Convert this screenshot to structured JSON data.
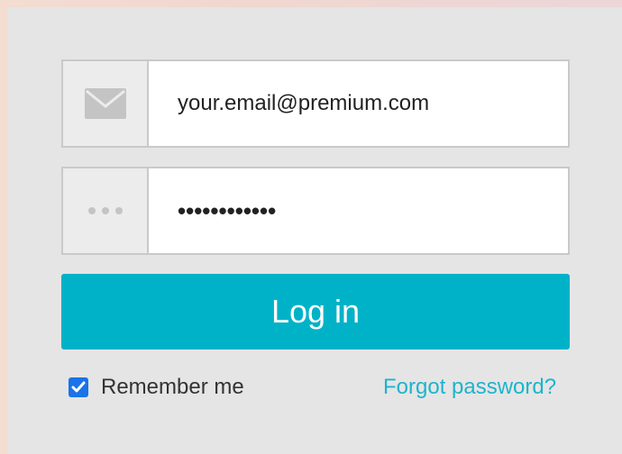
{
  "login_form": {
    "email": {
      "icon": "envelope-icon",
      "value": "your.email@premium.com"
    },
    "password": {
      "icon": "dots-icon",
      "value": "••••••••••••"
    },
    "login_button_label": "Log in",
    "remember_me": {
      "label": "Remember me",
      "checked": true
    },
    "forgot_password_label": "Forgot password?"
  },
  "colors": {
    "accent": "#00b2c8",
    "link": "#1eb4cc",
    "checkbox": "#1a73e8",
    "panel_bg": "#e5e5e5"
  }
}
